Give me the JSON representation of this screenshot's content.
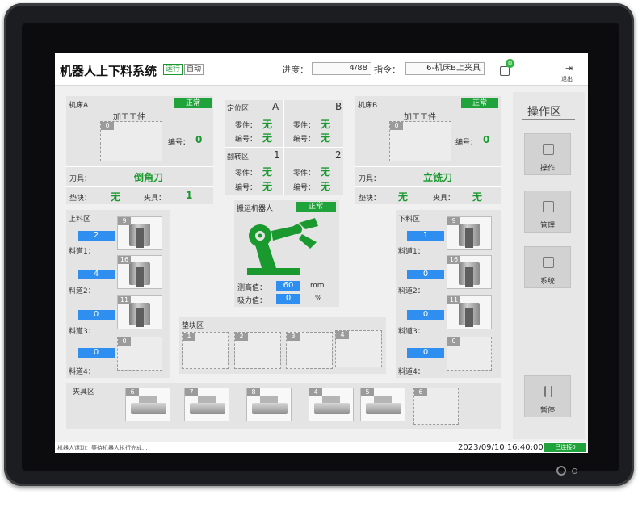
{
  "header": {
    "title": "机器人上下料系统",
    "mode_run": "运行",
    "mode_auto": "自动",
    "progress_label": "进度：",
    "progress_value": "4/88",
    "command_label": "指令：",
    "command_value": "6-机床B上夹具",
    "message_count": "0",
    "logout_label": "退出"
  },
  "machine_a": {
    "title": "机床A",
    "status": "正常",
    "workpiece_label": "加工工件",
    "slot_tag": "0",
    "number_label": "编号：",
    "number_value": "0",
    "tool_label": "刀具：",
    "tool_value": "倒角刀",
    "pad_label": "垫块：",
    "pad_value": "无",
    "fixture_label": "夹具：",
    "fixture_value": "1"
  },
  "machine_b": {
    "title": "机床B",
    "status": "正常",
    "workpiece_label": "加工工件",
    "slot_tag": "0",
    "number_label": "编号：",
    "number_value": "0",
    "tool_label": "刀具：",
    "tool_value": "立铣刀",
    "pad_label": "垫块：",
    "pad_value": "无",
    "fixture_label": "夹具：",
    "fixture_value": "无"
  },
  "positioning": {
    "title": "定位区",
    "col_a": "A",
    "col_b": "B",
    "part_label": "零件：",
    "number_label": "编号：",
    "a_part": "无",
    "a_number": "无",
    "b_part": "无",
    "b_number": "无"
  },
  "flip": {
    "title": "翻转区",
    "col_1": "1",
    "col_2": "2",
    "part_label": "零件：",
    "number_label": "编号：",
    "c1_part": "无",
    "c1_number": "无",
    "c2_part": "无",
    "c2_number": "无"
  },
  "robot": {
    "title": "搬运机器人",
    "status": "正常",
    "height_label": "测高值：",
    "height_value": "60",
    "height_unit": "mm",
    "suction_label": "吸力值：",
    "suction_value": "0",
    "suction_unit": "%"
  },
  "loading": {
    "title": "上料区",
    "lanes": [
      {
        "label": "料道1：",
        "count": "2",
        "tag": "9"
      },
      {
        "label": "料道2：",
        "count": "4",
        "tag": "16"
      },
      {
        "label": "料道3：",
        "count": "0",
        "tag": "11"
      },
      {
        "label": "料道4：",
        "count": "0",
        "tag": "0"
      }
    ]
  },
  "unloading": {
    "title": "下料区",
    "lanes": [
      {
        "label": "料道1：",
        "count": "1",
        "tag": "9"
      },
      {
        "label": "料道2：",
        "count": "0",
        "tag": "16"
      },
      {
        "label": "料道3：",
        "count": "0",
        "tag": "11"
      },
      {
        "label": "料道4：",
        "count": "0",
        "tag": "0"
      }
    ]
  },
  "pad_zone": {
    "title": "垫块区",
    "slots": [
      "1",
      "2",
      "3",
      "4"
    ]
  },
  "fixture_zone": {
    "title": "夹具区",
    "slots": [
      "6",
      "7",
      "8",
      "4",
      "5",
      "6"
    ]
  },
  "side": {
    "title": "操作区",
    "buttons": [
      "操作",
      "管理",
      "系统",
      "暂停"
    ]
  },
  "statusbar": {
    "message": "机器人运动：等待机器人执行完成...",
    "datetime": "2023/09/10 16:40:00",
    "connection": "已连接0"
  }
}
